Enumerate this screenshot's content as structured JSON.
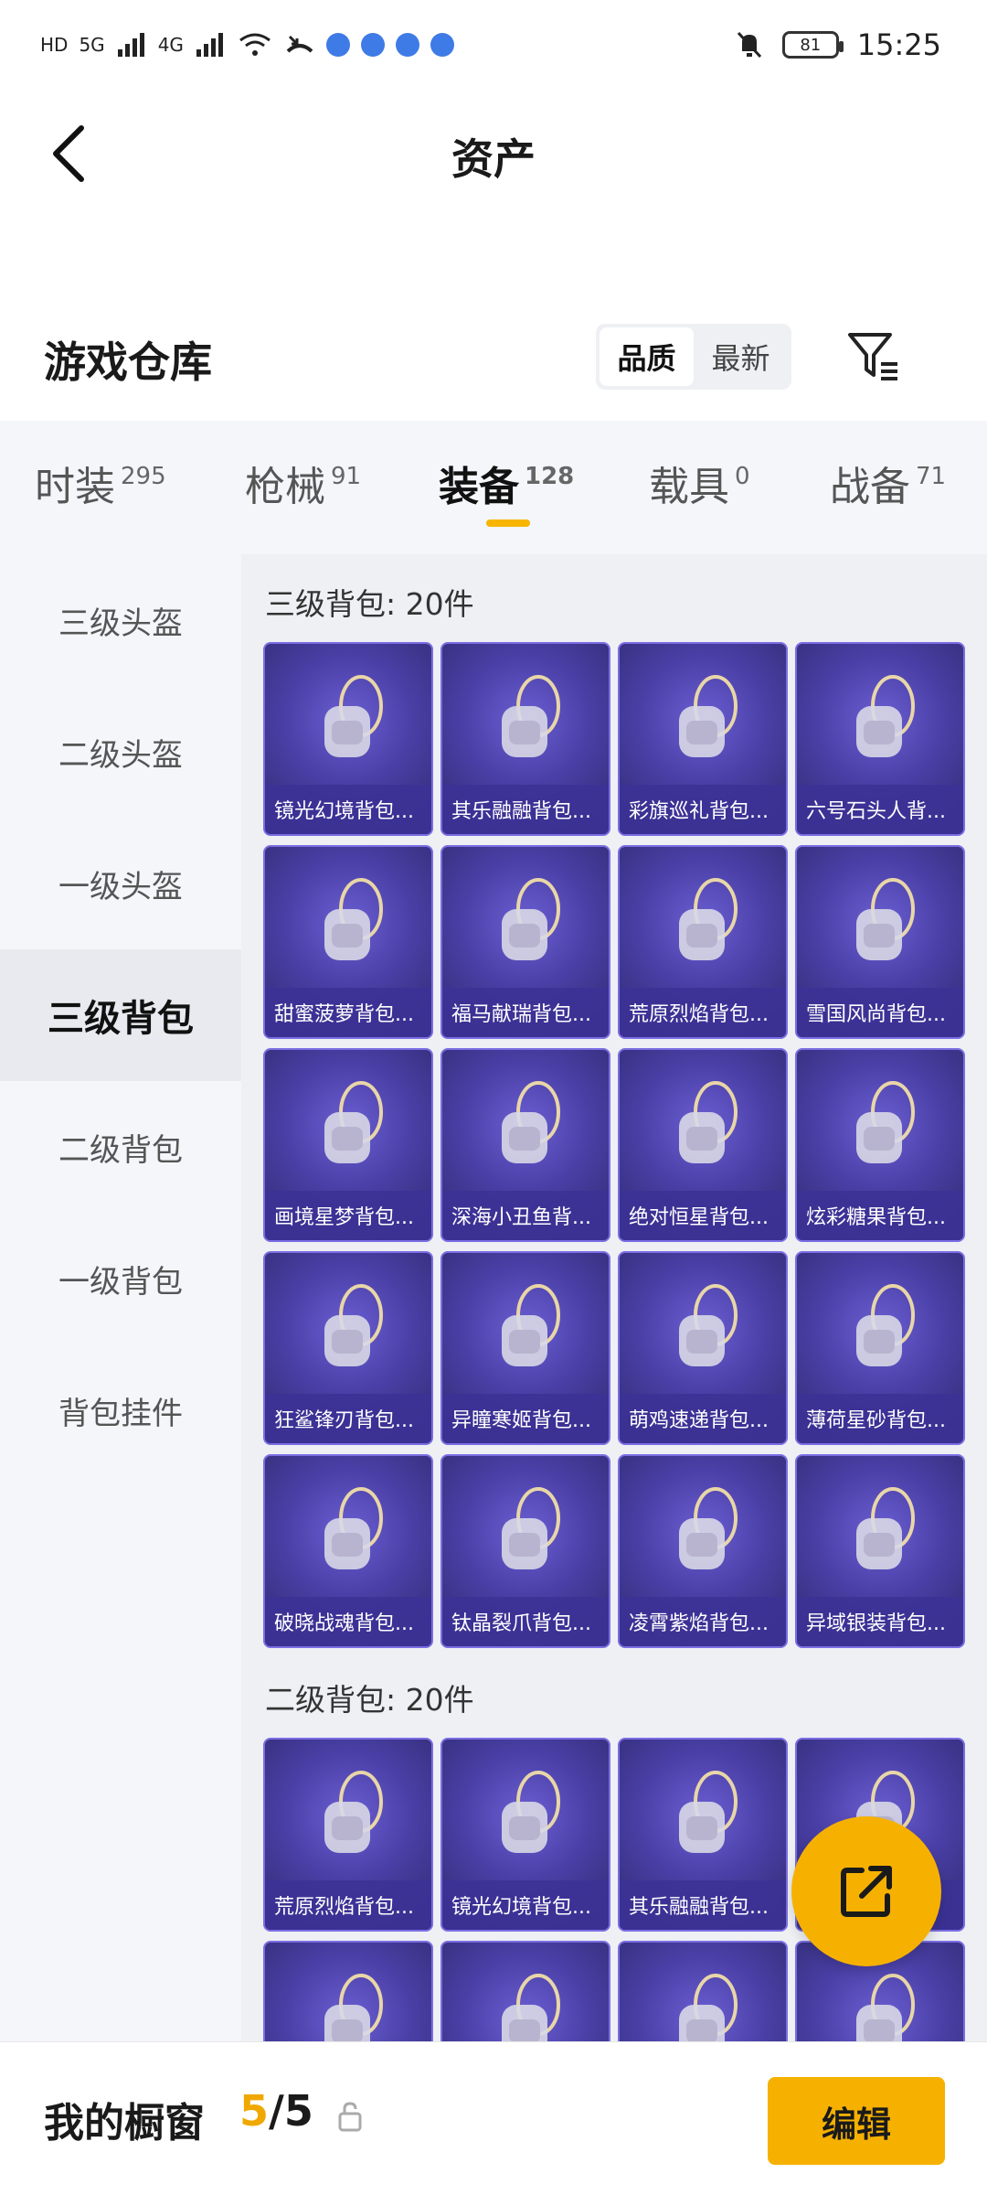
{
  "status_bar": {
    "left_labels": [
      "HD",
      "5G",
      "4G"
    ],
    "battery": "81",
    "time": "15:25"
  },
  "title": {
    "text": "资产"
  },
  "header": {
    "title": "游戏仓库",
    "sort_options": [
      "品质",
      "最新"
    ]
  },
  "tabs": [
    {
      "label": "时装",
      "count": "295"
    },
    {
      "label": "枪械",
      "count": "91"
    },
    {
      "label": "装备",
      "count": "128"
    },
    {
      "label": "载具",
      "count": "0"
    },
    {
      "label": "战备",
      "count": "71"
    }
  ],
  "sidebar": [
    {
      "label": "三级头盔"
    },
    {
      "label": "二级头盔"
    },
    {
      "label": "一级头盔"
    },
    {
      "label": "三级背包"
    },
    {
      "label": "二级背包"
    },
    {
      "label": "一级背包"
    },
    {
      "label": "背包挂件"
    }
  ],
  "groups": [
    {
      "title": "三级背包: 20件",
      "items": [
        "镜光幻境背包...",
        "其乐融融背包...",
        "彩旗巡礼背包...",
        "六号石头人背...",
        "甜蜜菠萝背包...",
        "福马献瑞背包...",
        "荒原烈焰背包...",
        "雪国风尚背包...",
        "画境星梦背包...",
        "深海小丑鱼背...",
        "绝对恒星背包...",
        "炫彩糖果背包...",
        "狂鲨锋刃背包...",
        "异瞳寒姬背包...",
        "萌鸡速递背包...",
        "薄荷星砂背包...",
        "破晓战魂背包...",
        "钛晶裂爪背包...",
        "凌霄紫焰背包...",
        "异域银装背包..."
      ]
    },
    {
      "title": "二级背包: 20件",
      "items": [
        "荒原烈焰背包...",
        "镜光幻境背包...",
        "其乐融融背包...",
        "",
        "",
        "",
        "",
        ""
      ]
    }
  ],
  "bottom": {
    "title": "我的橱窗",
    "count_current": "5",
    "count_total": "/5",
    "edit_label": "编辑"
  },
  "colors": {
    "accent": "#f6b100",
    "card_bg": "#4a3fa6"
  }
}
